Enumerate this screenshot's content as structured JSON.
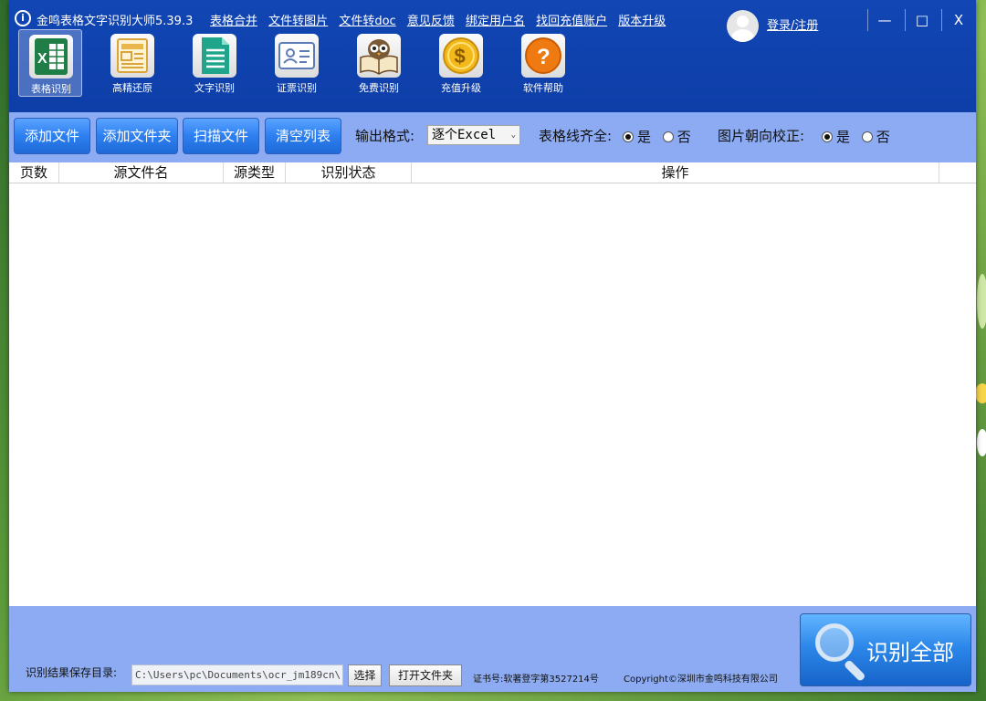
{
  "window": {
    "title": "金鸣表格文字识别大师5.39.3",
    "logo_icon": "jinming-logo-icon",
    "top_links": [
      "表格合并",
      "文件转图片",
      "文件转doc",
      "意见反馈",
      "绑定用户名",
      "找回充值账户",
      "版本升级"
    ],
    "login_label": "登录/注册",
    "minimize": "—",
    "maximize": "□",
    "close": "X"
  },
  "toolbar": {
    "tools": [
      {
        "label": "表格识别",
        "icon": "excel-icon",
        "active": true
      },
      {
        "label": "高精还原",
        "icon": "layout-icon",
        "active": false
      },
      {
        "label": "文字识别",
        "icon": "document-icon",
        "active": false
      },
      {
        "label": "证票识别",
        "icon": "id-card-icon",
        "active": false
      },
      {
        "label": "免费识别",
        "icon": "owl-book-icon",
        "active": false
      },
      {
        "label": "充值升级",
        "icon": "dollar-coin-icon",
        "active": false
      },
      {
        "label": "软件帮助",
        "icon": "help-icon",
        "active": false
      }
    ]
  },
  "controls": {
    "add_file": "添加文件",
    "add_folder": "添加文件夹",
    "scan_file": "扫描文件",
    "clear_list": "清空列表",
    "output_format_label": "输出格式:",
    "output_format_value": "逐个Excel",
    "table_line_label": "表格线齐全:",
    "orientation_label": "图片朝向校正:",
    "yes": "是",
    "no": "否",
    "table_line_selected": "是",
    "orientation_selected": "是"
  },
  "table": {
    "columns": [
      "页数",
      "源文件名",
      "源类型",
      "识别状态",
      "操作"
    ],
    "rows": []
  },
  "bottom": {
    "save_dir_label": "识别结果保存目录:",
    "save_dir_value": "C:\\Users\\pc\\Documents\\ocr_jm189cn\\",
    "choose_button": "选择",
    "open_folder_button": "打开文件夹",
    "certificate": "证书号:软著登字第3527214号",
    "copyright": "Copyright©深圳市金鸣科技有限公司",
    "recognize_all": "识别全部"
  },
  "colors": {
    "header_bg": "#1146b4",
    "panel_bg": "#8cabf2",
    "button_blue": "#2d7ff0"
  }
}
